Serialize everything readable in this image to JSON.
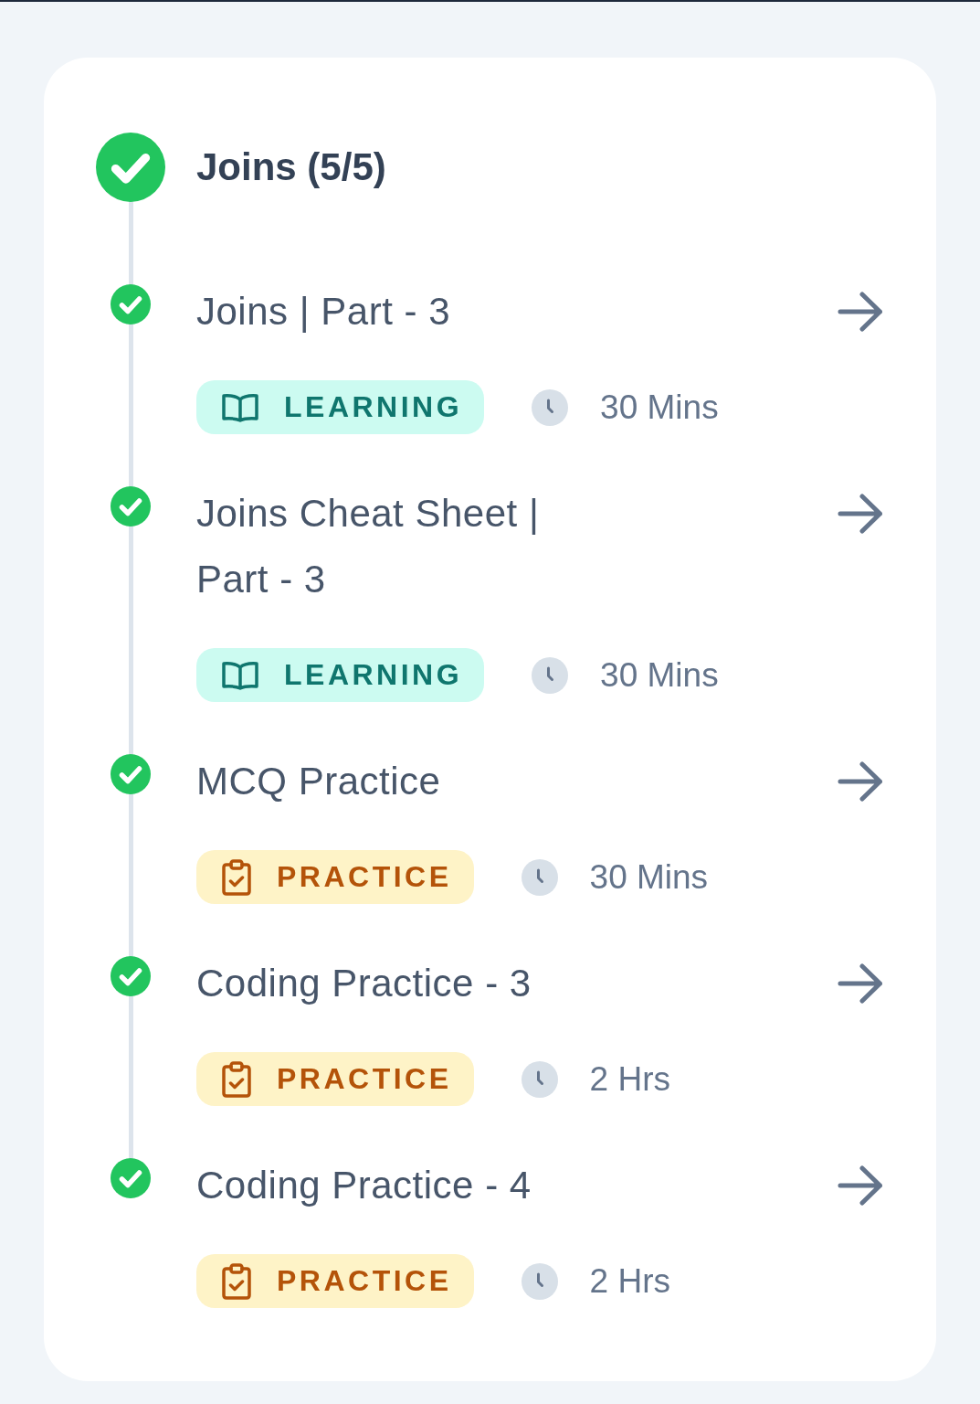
{
  "section": {
    "title": "Joins (5/5)",
    "completed": true
  },
  "items": [
    {
      "title": "Joins | Part - 3",
      "completed": true,
      "kind": "learning",
      "tag": "LEARNING",
      "duration": "30 Mins"
    },
    {
      "title": "Joins Cheat Sheet | Part - 3",
      "completed": true,
      "kind": "learning",
      "tag": "LEARNING",
      "duration": "30 Mins"
    },
    {
      "title": "MCQ Practice",
      "completed": true,
      "kind": "practice",
      "tag": "PRACTICE",
      "duration": "30 Mins"
    },
    {
      "title": "Coding Practice - 3",
      "completed": true,
      "kind": "practice",
      "tag": "PRACTICE",
      "duration": "2 Hrs"
    },
    {
      "title": "Coding Practice - 4",
      "completed": true,
      "kind": "practice",
      "tag": "PRACTICE",
      "duration": "2 Hrs"
    }
  ]
}
